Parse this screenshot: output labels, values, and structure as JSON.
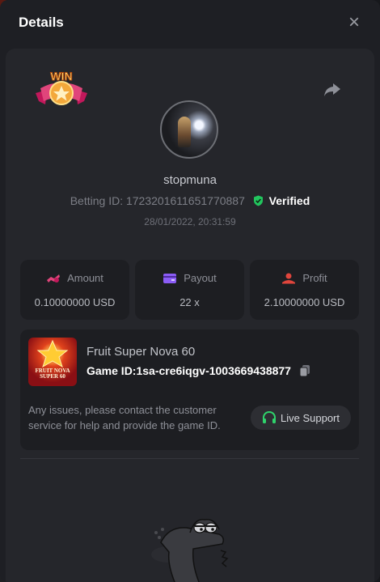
{
  "modal": {
    "title": "Details",
    "close_glyph": "×"
  },
  "bet": {
    "badge_text": "WIN",
    "username": "stopmuna",
    "betting_id_label": "Betting ID:",
    "betting_id": "1723201611651770887",
    "verified_label": "Verified",
    "datetime": "28/01/2022, 20:31:59"
  },
  "stats": [
    {
      "label": "Amount",
      "value": "0.10000000 USD",
      "icon": "amount-icon"
    },
    {
      "label": "Payout",
      "value": "22 x",
      "icon": "payout-icon"
    },
    {
      "label": "Profit",
      "value": "2.10000000 USD",
      "icon": "profit-icon"
    }
  ],
  "game": {
    "name": "Fruit Super Nova 60",
    "game_id_label": "Game ID:",
    "game_id": "1sa-cre6iqgv-1003669438877",
    "thumb_text": "FRUIT NOVA SUPER 60",
    "help_text": "Any issues, please contact the customer service for help and provide the game ID.",
    "live_support_label": "Live Support"
  },
  "colors": {
    "verified_green": "#22c55e",
    "amount_pink": "#e0457b",
    "payout_purple": "#8b5cf6",
    "profit_red": "#e0453c",
    "support_green": "#2fd36b"
  }
}
